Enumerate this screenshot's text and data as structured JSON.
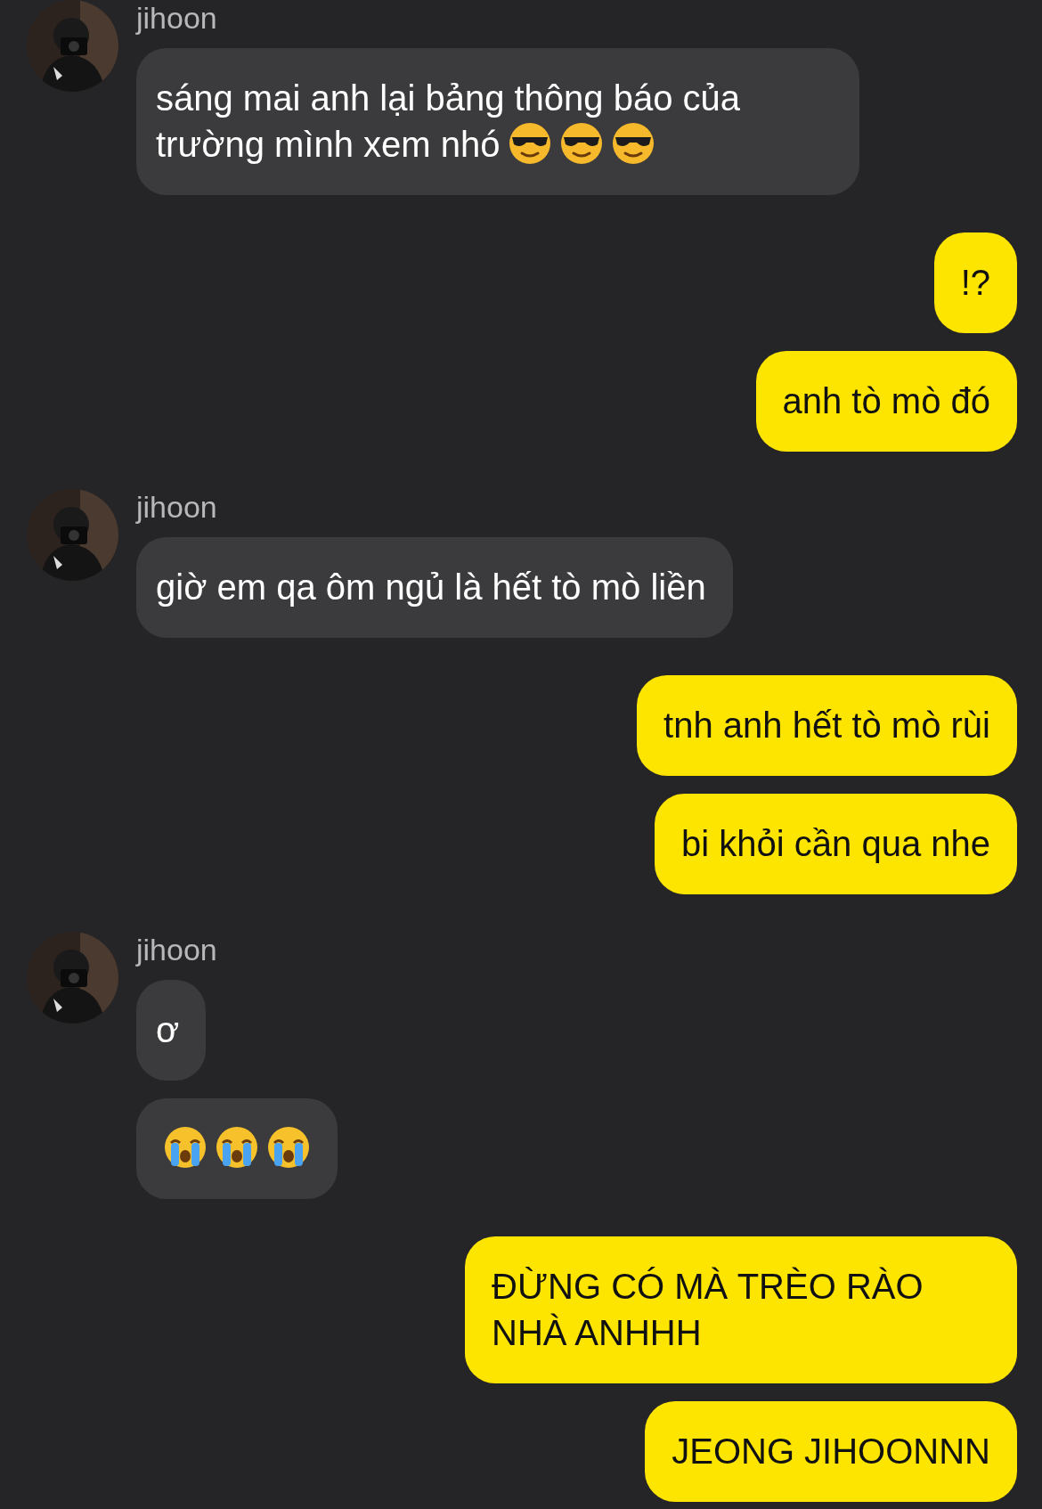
{
  "messages": [
    {
      "kind": "received",
      "sender": "jihoon",
      "bubbles": [
        {
          "text": "sáng mai anh lại bảng thông báo của trường mình xem nhó",
          "emojis": [
            {
              "kind": "sunglasses"
            },
            {
              "kind": "sunglasses"
            },
            {
              "kind": "sunglasses"
            }
          ]
        }
      ]
    },
    {
      "kind": "sent",
      "bubbles": [
        {
          "text": "!?"
        },
        {
          "text": "anh tò mò đó"
        }
      ]
    },
    {
      "kind": "received",
      "sender": "jihoon",
      "bubbles": [
        {
          "text": "giờ em qa ôm ngủ là hết tò mò liền"
        }
      ]
    },
    {
      "kind": "sent",
      "bubbles": [
        {
          "text": "tnh anh hết tò mò rùi"
        },
        {
          "text": "bi khỏi cần qua nhe"
        }
      ]
    },
    {
      "kind": "received",
      "sender": "jihoon",
      "bubbles": [
        {
          "text": "ơ"
        },
        {
          "emojis": [
            {
              "kind": "crying"
            },
            {
              "kind": "crying"
            },
            {
              "kind": "crying"
            }
          ]
        }
      ]
    },
    {
      "kind": "sent",
      "bubbles": [
        {
          "text": "ĐỪNG CÓ MÀ TRÈO RÀO NHÀ ANHHH"
        },
        {
          "text": "JEONG JIHOONNN"
        }
      ]
    }
  ]
}
